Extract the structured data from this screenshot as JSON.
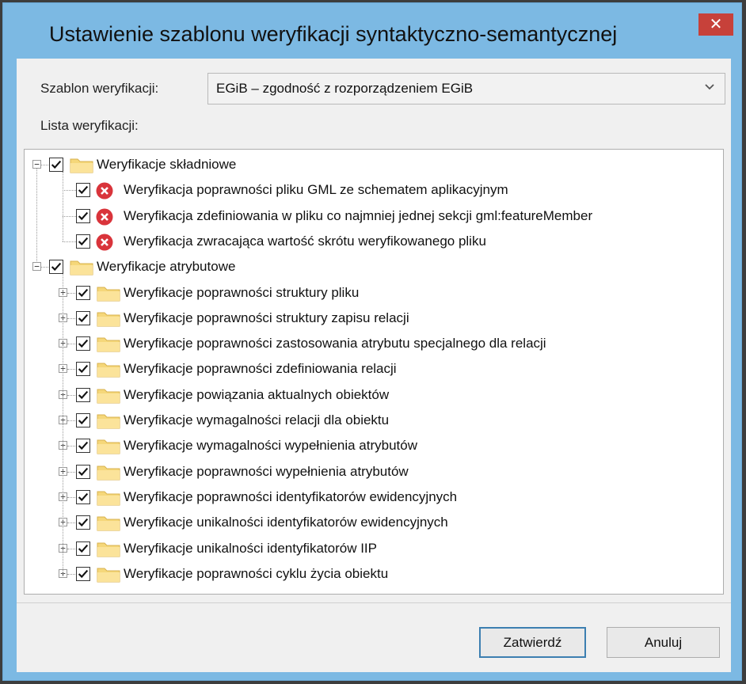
{
  "window": {
    "title": "Ustawienie szablonu weryfikacji syntaktyczno-semantycznej",
    "close_label": "✕"
  },
  "template": {
    "label": "Szablon weryfikacji:",
    "value": "EGiB – zgodność z rozporządzeniem EGiB"
  },
  "list": {
    "label": "Lista weryfikacji:"
  },
  "tree": {
    "groups": [
      {
        "label": "Weryfikacje składniowe",
        "checked": true,
        "expanded": true,
        "children": [
          {
            "label": "Weryfikacja poprawności pliku GML ze schematem aplikacyjnym",
            "icon": "error-icon",
            "checked": true
          },
          {
            "label": "Weryfikacja zdefiniowania w pliku co najmniej jednej sekcji gml:featureMember",
            "icon": "error-icon",
            "checked": true
          },
          {
            "label": "Weryfikacja zwracająca wartość skrótu weryfikowanego pliku",
            "icon": "error-icon",
            "checked": true
          }
        ]
      },
      {
        "label": "Weryfikacje atrybutowe",
        "checked": true,
        "expanded": true,
        "children": [
          {
            "label": "Weryfikacje poprawności struktury pliku",
            "icon": "folder-icon",
            "checked": true
          },
          {
            "label": "Weryfikacje poprawności struktury zapisu relacji",
            "icon": "folder-icon",
            "checked": true
          },
          {
            "label": "Weryfikacje poprawności zastosowania atrybutu specjalnego dla relacji",
            "icon": "folder-icon",
            "checked": true
          },
          {
            "label": "Weryfikacje poprawności zdefiniowania relacji",
            "icon": "folder-icon",
            "checked": true
          },
          {
            "label": "Weryfikacje powiązania aktualnych obiektów",
            "icon": "folder-icon",
            "checked": true
          },
          {
            "label": "Weryfikacje wymagalności relacji dla obiektu",
            "icon": "folder-icon",
            "checked": true
          },
          {
            "label": "Weryfikacje wymagalności wypełnienia atrybutów",
            "icon": "folder-icon",
            "checked": true
          },
          {
            "label": "Weryfikacje poprawności wypełnienia atrybutów",
            "icon": "folder-icon",
            "checked": true
          },
          {
            "label": "Weryfikacje poprawności identyfikatorów ewidencyjnych",
            "icon": "folder-icon",
            "checked": true
          },
          {
            "label": "Weryfikacje unikalności identyfikatorów ewidencyjnych",
            "icon": "folder-icon",
            "checked": true
          },
          {
            "label": "Weryfikacje unikalności identyfikatorów IIP",
            "icon": "folder-icon",
            "checked": true
          },
          {
            "label": "Weryfikacje poprawności cyklu życia obiektu",
            "icon": "folder-icon",
            "checked": true
          }
        ]
      }
    ]
  },
  "buttons": {
    "confirm": "Zatwierdź",
    "cancel": "Anuluj"
  },
  "colors": {
    "frame": "#7cb9e3",
    "close": "#c7413a",
    "error": "#d9343b",
    "folder": "#f5d77a",
    "primary_border": "#3c7fb1"
  }
}
